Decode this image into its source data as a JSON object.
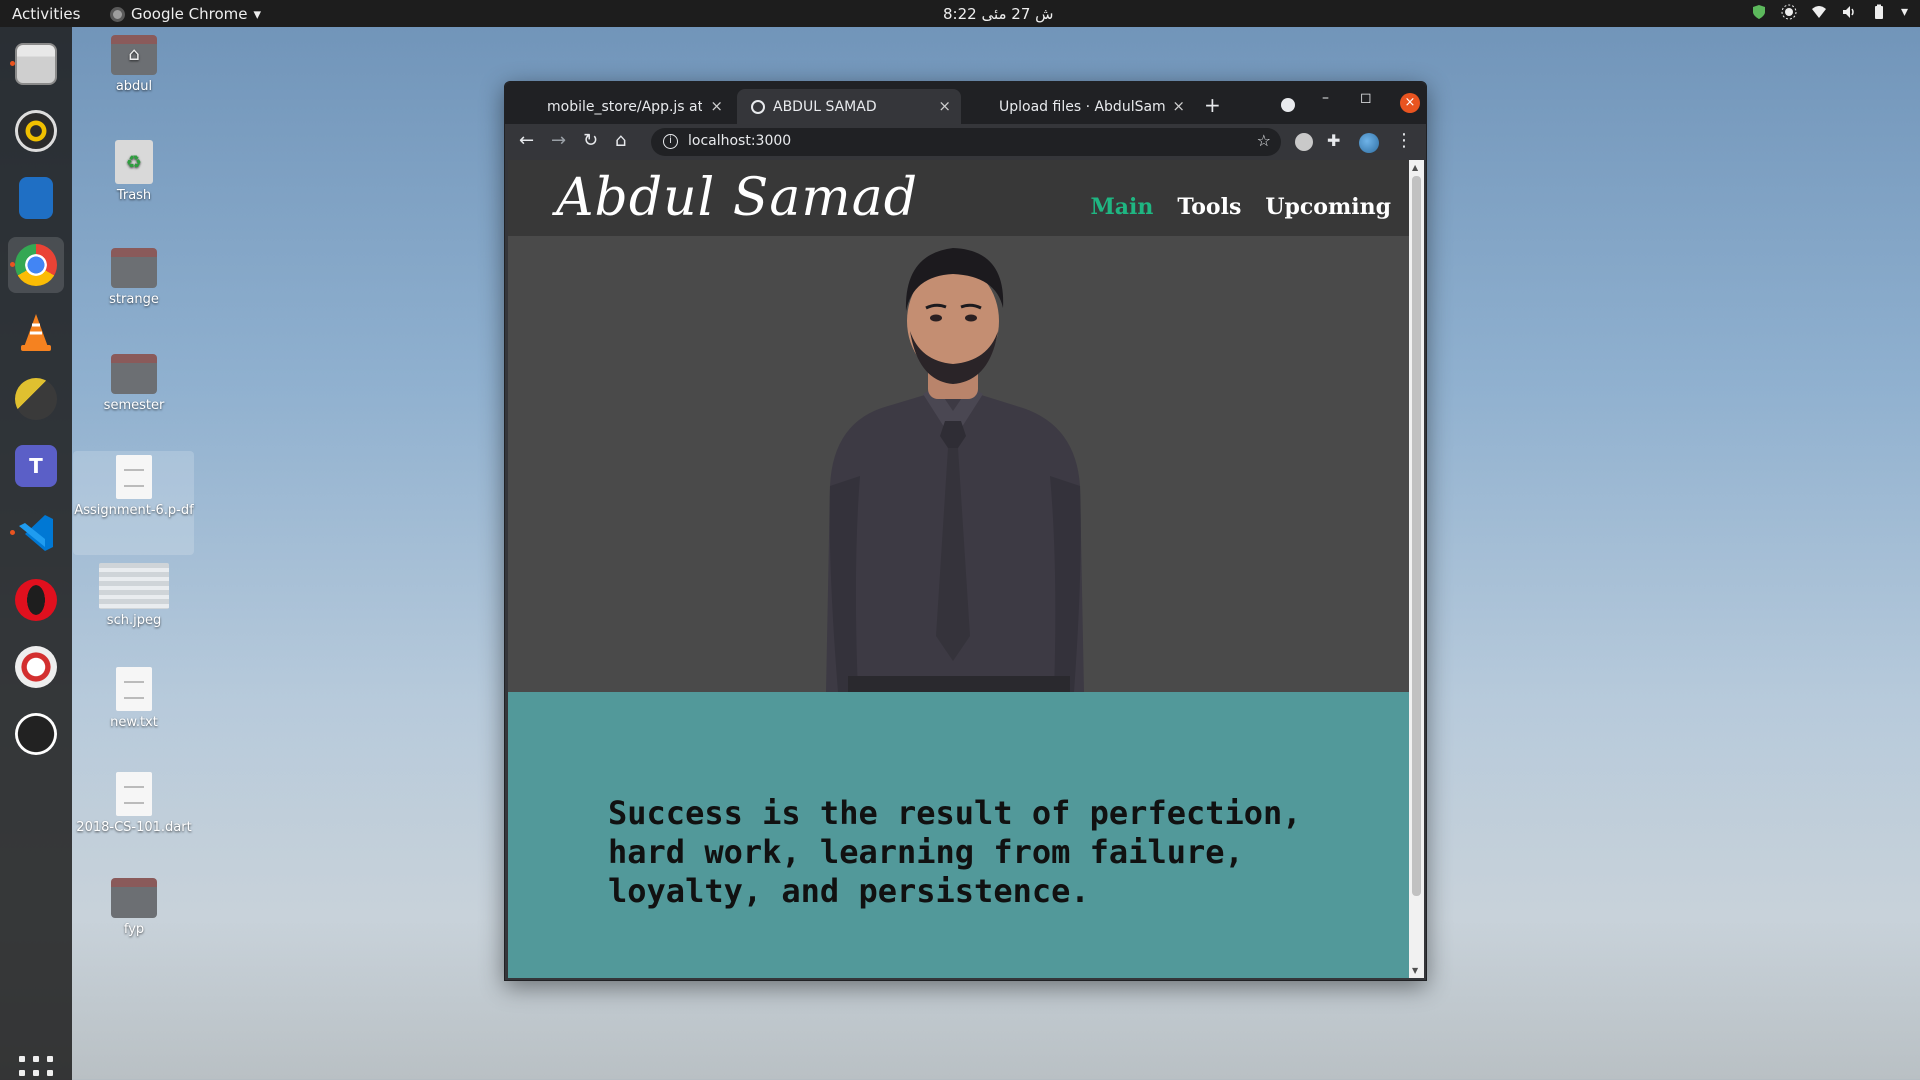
{
  "topbar": {
    "activities": "Activities",
    "app_name": "Google Chrome",
    "app_arrow": "▾",
    "clock": "8:22 ش  27 مئی",
    "tray_menu_arrow": "▾"
  },
  "dock": {
    "items": [
      "files-icon",
      "rhythmbox-icon",
      "writer-icon",
      "chrome-icon",
      "vlc-icon",
      "app-icon",
      "teams-icon",
      "vscode-icon",
      "opera-icon",
      "help-icon",
      "obs-icon"
    ],
    "show_apps": "show-applications-icon"
  },
  "desktop": {
    "icons": [
      {
        "label": "abdul"
      },
      {
        "label": "Trash"
      },
      {
        "label": "strange"
      },
      {
        "label": "semester"
      },
      {
        "label": "Assignment-6.p-df"
      },
      {
        "label": "sch.jpeg"
      },
      {
        "label": "new.txt"
      },
      {
        "label": "2018-CS-101.dart"
      },
      {
        "label": "fyp"
      }
    ]
  },
  "browser": {
    "tabs": [
      {
        "title": "mobile_store/App.js at",
        "close": "×"
      },
      {
        "title": "ABDUL SAMAD",
        "close": "×"
      },
      {
        "title": "Upload files · AbdulSam",
        "close": "×"
      }
    ],
    "new_tab": "+",
    "window_buttons": {
      "minimize": "–",
      "maximize": "◻",
      "close": "×"
    },
    "toolbar": {
      "back": "←",
      "forward": "→",
      "reload": "↻",
      "home": "⌂",
      "info": "i",
      "star": "☆",
      "menu": "⋮"
    },
    "url": "localhost:3000"
  },
  "site": {
    "logo": "Abdul Samad",
    "nav": [
      "Main",
      "Tools",
      "Upcoming"
    ],
    "quote": "Success is the result of perfection, hard work, learning from failure, loyalty, and persistence."
  },
  "colors": {
    "accent_nav": "#1fb682",
    "quote_bg": "#52999a",
    "hero_bg": "#4a4a4a",
    "close_button": "#e95420"
  }
}
